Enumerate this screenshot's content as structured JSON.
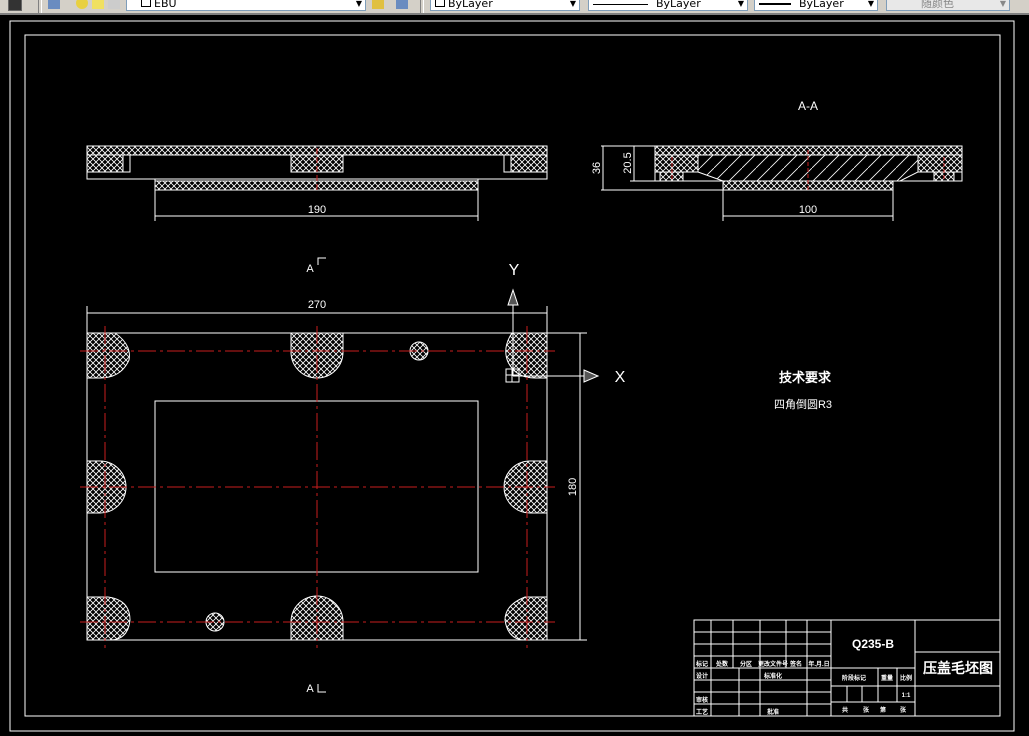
{
  "toolbar": {
    "layer_value": "EBU",
    "color_value": "ByLayer",
    "linetype_value": "ByLayer",
    "lineweight_value": "ByLayer",
    "plotstyle_value": "随颜色"
  },
  "drawing": {
    "top_view": {
      "dim_width": "190"
    },
    "section_aa": {
      "title": "A-A",
      "dim_height_total": "36",
      "dim_height_inner": "20.5",
      "dim_width": "100"
    },
    "plan_view": {
      "section_mark_top": "A",
      "section_mark_bottom": "A",
      "dim_length": "270",
      "dim_height": "180"
    },
    "ucs": {
      "x_label": "X",
      "y_label": "Y"
    },
    "tech_requirements": {
      "heading": "技术要求",
      "item1": "四角倒圆R3"
    },
    "title_block": {
      "material": "Q235-B",
      "drawing_name": "压盖毛坯图",
      "rev_headers": [
        "标记",
        "处数",
        "分区",
        "更改文件号",
        "签名",
        "年.月.日"
      ],
      "design": "设计",
      "standardize": "标准化",
      "review": "审核",
      "process": "工艺",
      "approve": "批准",
      "stage_mark": "阶段标记",
      "weight": "重量",
      "scale": "比例",
      "scale_value": "1:1",
      "sheet_total": "共",
      "sheet_unit1": "张",
      "sheet_no": "第",
      "sheet_unit2": "张"
    }
  },
  "colors": {
    "centerline": "#c81e1e",
    "line": "#ffffff",
    "background": "#000000"
  }
}
